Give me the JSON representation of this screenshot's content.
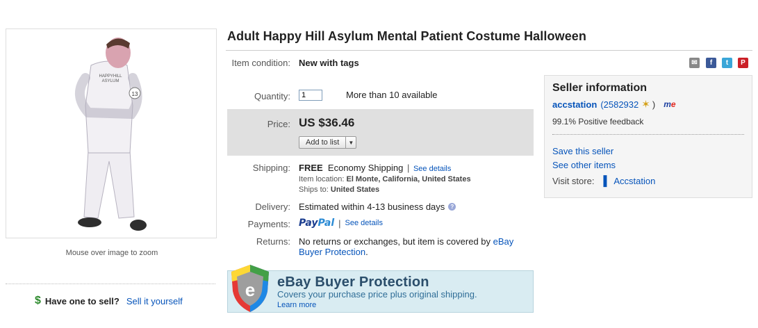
{
  "product": {
    "title": "Adult Happy Hill Asylum Mental Patient Costume Halloween",
    "image_text": {
      "line1": "HAPPYHILL",
      "line2": "ASYLUM",
      "badge": "13"
    }
  },
  "left": {
    "zoom_hint": "Mouse over image to zoom",
    "sell_question": "Have one to sell?",
    "sell_link": "Sell it yourself",
    "dollar_icon": "$"
  },
  "details": {
    "condition_label": "Item condition:",
    "condition_value": "New with tags",
    "quantity_label": "Quantity:",
    "quantity_value": "1",
    "quantity_available": "More than 10 available",
    "price_label": "Price:",
    "price_value": "US $36.46",
    "add_to_list": "Add to list",
    "shipping_label": "Shipping:",
    "shipping_free": "FREE",
    "shipping_method": "Economy Shipping",
    "shipping_sep": "|",
    "shipping_details_link": "See details",
    "item_location_label": "Item location:",
    "item_location": "El Monte, California, United States",
    "ships_to_label": "Ships to:",
    "ships_to": "United States",
    "delivery_label": "Delivery:",
    "delivery_value": "Estimated within 4-13 business days",
    "payments_label": "Payments:",
    "paypal_part1": "Pay",
    "paypal_part2": "Pal",
    "payments_sep": "|",
    "payments_details_link": "See details",
    "returns_label": "Returns:",
    "returns_text": "No returns or exchanges, but item is covered by ",
    "returns_link": "eBay Buyer Protection",
    "returns_end": "."
  },
  "buyer_protection": {
    "title": "eBay Buyer Protection",
    "subtitle": "Covers your purchase price plus original shipping.",
    "learn_more": "Learn more",
    "shield_letter": "e"
  },
  "share": {
    "mail": "✉",
    "facebook": "f",
    "twitter": "t",
    "pinterest": "P"
  },
  "seller": {
    "heading": "Seller information",
    "name": "accstation",
    "score_open": "(2582932",
    "score_close": ")",
    "me_part1": "m",
    "me_part2": "e",
    "feedback": "99.1% Positive feedback",
    "save_seller": "Save this seller",
    "other_items": "See other items",
    "visit_store_label": "Visit store:",
    "store_name": "Accstation"
  },
  "colors": {
    "link": "#0654ba",
    "price_band": "#e0e0e0",
    "banner_bg": "#d9ecf2",
    "seller_panel_bg": "#f5f5f5"
  }
}
